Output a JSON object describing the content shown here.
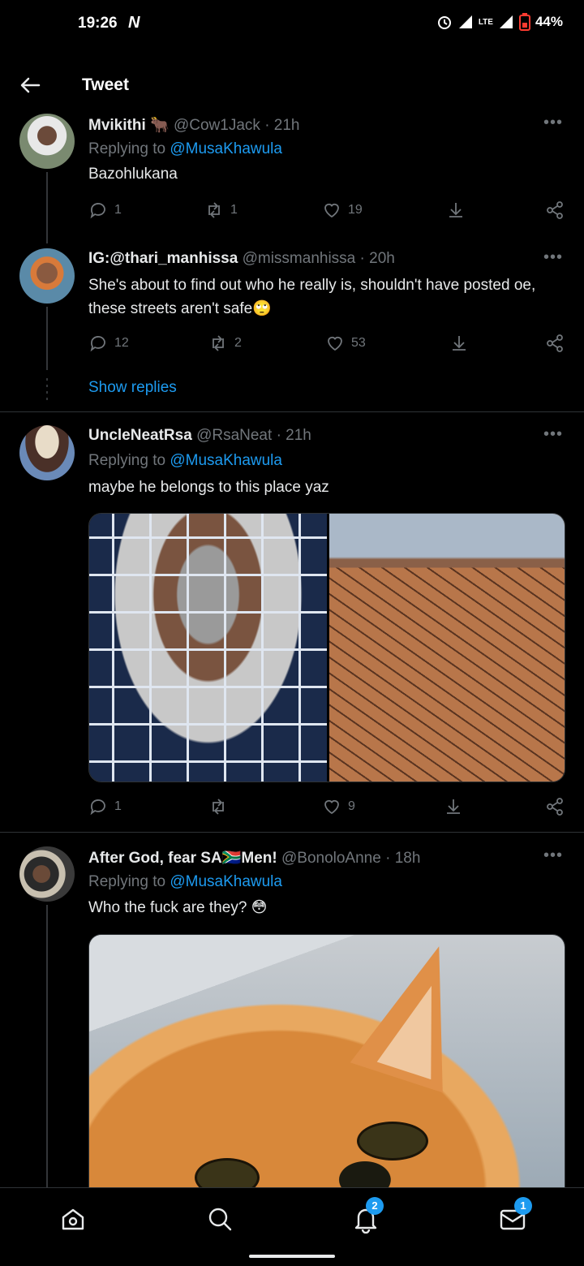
{
  "status_bar": {
    "time": "19:26",
    "notif_glyph": "N",
    "network": "LTE",
    "battery": "44%"
  },
  "header": {
    "title": "Tweet"
  },
  "replies": [
    {
      "name": "Mvikithi",
      "name_emoji": "🐂",
      "handle": "@Cow1Jack",
      "time": "· 21h",
      "replying_prefix": "Replying to",
      "replying_to": "@MusaKhawula",
      "text": "Bazohlukana",
      "reply_count": "1",
      "retweet_count": "1",
      "like_count": "19"
    },
    {
      "name": "IG:@thari_manhissa",
      "handle": "@missmanhissa",
      "time": "· 20h",
      "text": "She's about to find out who he really is, shouldn't have posted oe, these streets aren't safe",
      "text_emoji": "🙄",
      "reply_count": "12",
      "retweet_count": "2",
      "like_count": "53",
      "show_replies": "Show replies"
    },
    {
      "name": "UncleNeatRsa",
      "handle": "@RsaNeat",
      "time": "· 21h",
      "replying_prefix": "Replying to",
      "replying_to": "@MusaKhawula",
      "text": "maybe he belongs to this place yaz",
      "reply_count": "1",
      "retweet_count": "",
      "like_count": "9"
    },
    {
      "name": "After God, fear SA",
      "name_flag": "🇿🇦",
      "name_suffix": "Men!",
      "handle": "@BonoloAnne",
      "time": "· 18h",
      "replying_prefix": "Replying to",
      "replying_to": "@MusaKhawula",
      "text": "Who the fuck are they?",
      "text_emoji": "😳"
    }
  ],
  "bottom_nav": {
    "notifications_badge": "2",
    "messages_badge": "1"
  },
  "colors": {
    "accent": "#1d9bf0",
    "background": "#000000",
    "muted": "#71767b",
    "text": "#e7e9ea"
  }
}
